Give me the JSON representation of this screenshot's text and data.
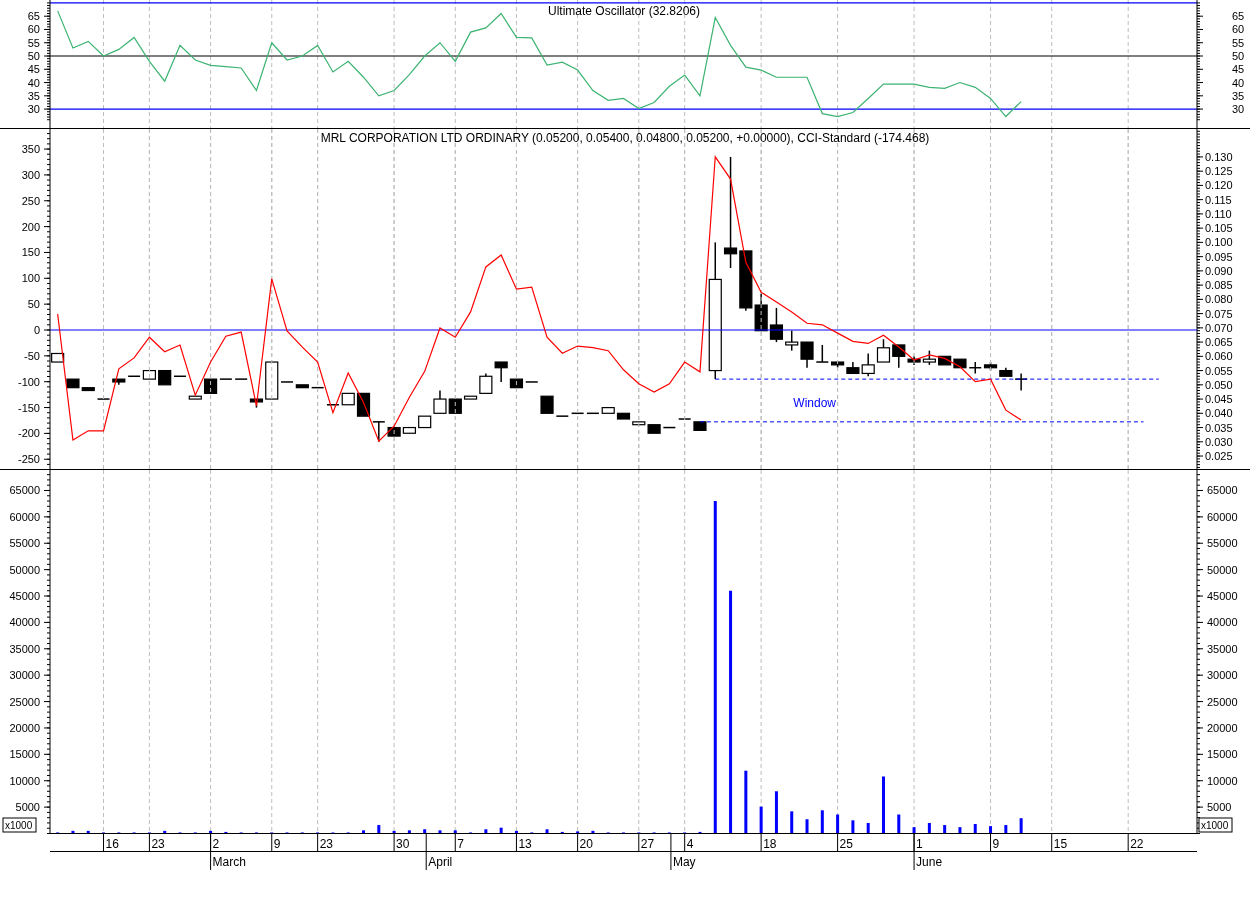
{
  "oscillator_panel": {
    "chart_data": {
      "type": "line",
      "title": "Ultimate Oscillator (32.8206)",
      "grid": true,
      "categories": [
        null,
        null,
        null,
        null,
        null,
        null,
        null,
        null,
        null,
        null,
        null,
        null,
        null,
        null,
        null,
        null,
        null,
        null,
        null,
        null,
        null,
        null,
        null,
        null,
        null,
        null,
        null,
        null,
        null,
        null,
        null,
        null,
        null,
        null,
        null,
        null,
        null,
        null,
        null,
        null,
        null,
        null,
        null,
        null,
        null,
        null,
        null,
        null,
        null,
        null,
        null,
        null,
        null,
        null,
        null,
        null,
        null,
        null,
        null,
        null,
        null,
        null,
        null,
        null,
        null,
        null,
        null,
        null,
        null,
        null,
        null,
        null,
        null,
        null,
        null
      ],
      "series": [
        {
          "color": "#3cb371",
          "values": [
            67,
            53,
            55.5,
            50,
            52.5,
            57,
            48,
            40.5,
            54,
            48.5,
            46.5,
            46,
            45.5,
            37,
            55,
            48.5,
            50,
            54,
            44,
            48,
            42,
            35,
            37,
            43,
            50,
            55,
            48,
            59,
            60.6,
            66,
            57,
            56.8,
            46.6,
            47.7,
            44.7,
            37,
            33.3,
            34,
            30.2,
            32.5,
            38.6,
            42.8,
            35,
            64.5,
            54,
            45.8,
            44.7,
            42,
            42,
            42,
            28.3,
            27.2,
            28.7,
            34,
            39.4,
            39.4,
            39.4,
            38.2,
            37.8,
            40,
            38.2,
            34,
            27.2,
            32.8,
            null,
            null,
            null,
            null,
            null,
            null,
            null,
            null,
            null,
            null,
            null
          ]
        }
      ],
      "ylim": [
        22.5,
        71.1
      ],
      "yticks": [
        30,
        35,
        40,
        45,
        50,
        55,
        60,
        65
      ],
      "y2lim": [
        22.5,
        71.1
      ],
      "y2ticks": [
        30,
        35,
        40,
        45,
        50,
        55,
        60,
        65
      ],
      "ref_lines": [
        {
          "axis": "y",
          "value": 70,
          "color": "#0000ff"
        },
        {
          "axis": "y",
          "value": 50,
          "color": "#000000"
        },
        {
          "axis": "y",
          "value": 30,
          "color": "#0000ff"
        }
      ]
    }
  },
  "price_panel": {
    "title": "MRL CORPORATION LTD ORDINARY (0.05200, 0.05400, 0.04800, 0.05200, +0.00000), CCI-Standard (-174.468)",
    "price_chart": {
      "chart_data": {
        "type": "candlestick",
        "grid": true,
        "categories": [
          null,
          null,
          null,
          null,
          null,
          null,
          null,
          null,
          null,
          null,
          null,
          null,
          null,
          null,
          null,
          null,
          null,
          null,
          null,
          null,
          null,
          null,
          null,
          null,
          null,
          null,
          null,
          null,
          null,
          null,
          null,
          null,
          null,
          null,
          null,
          null,
          null,
          null,
          null,
          null,
          null,
          null,
          null,
          null,
          null,
          null,
          null,
          null,
          null,
          null,
          null,
          null,
          null,
          null,
          null,
          null,
          null,
          null,
          null,
          null,
          null,
          null,
          null,
          null,
          null,
          null,
          null,
          null,
          null,
          null,
          null,
          null,
          null,
          null,
          null
        ],
        "ohlc": [
          [
            0.058,
            0.061,
            0.058,
            0.061
          ],
          [
            0.052,
            0.052,
            0.049,
            0.049
          ],
          [
            0.049,
            0.049,
            0.048,
            0.048
          ],
          [
            0.045,
            0.045,
            0.045,
            0.045
          ],
          [
            0.052,
            0.052,
            0.05,
            0.051
          ],
          [
            0.053,
            0.053,
            0.053,
            0.053
          ],
          [
            0.052,
            0.055,
            0.052,
            0.055
          ],
          [
            0.055,
            0.055,
            0.05,
            0.05
          ],
          [
            0.053,
            0.053,
            0.053,
            0.053
          ],
          [
            0.045,
            0.046,
            0.045,
            0.046
          ],
          [
            0.052,
            0.052,
            0.047,
            0.047
          ],
          [
            0.052,
            0.052,
            0.052,
            0.052
          ],
          [
            0.052,
            0.052,
            0.052,
            0.052
          ],
          [
            0.045,
            0.045,
            0.042,
            0.044
          ],
          [
            0.045,
            0.058,
            0.045,
            0.058
          ],
          [
            0.051,
            0.051,
            0.051,
            0.051
          ],
          [
            0.05,
            0.05,
            0.049,
            0.049
          ],
          [
            0.049,
            0.049,
            0.049,
            0.049
          ],
          [
            0.043,
            0.043,
            0.043,
            0.043
          ],
          [
            0.043,
            0.047,
            0.043,
            0.047
          ],
          [
            0.047,
            0.047,
            0.039,
            0.039
          ],
          [
            0.037,
            0.037,
            0.03,
            0.037
          ],
          [
            0.035,
            0.035,
            0.032,
            0.032
          ],
          [
            0.033,
            0.035,
            0.033,
            0.035
          ],
          [
            0.035,
            0.039,
            0.035,
            0.039
          ],
          [
            0.04,
            0.048,
            0.04,
            0.045
          ],
          [
            0.045,
            0.045,
            0.04,
            0.04
          ],
          [
            0.045,
            0.046,
            0.045,
            0.046
          ],
          [
            0.047,
            0.054,
            0.047,
            0.053
          ],
          [
            0.058,
            0.058,
            0.051,
            0.056
          ],
          [
            0.052,
            0.052,
            0.049,
            0.049
          ],
          [
            0.051,
            0.051,
            0.051,
            0.051
          ],
          [
            0.046,
            0.046,
            0.04,
            0.04
          ],
          [
            0.039,
            0.039,
            0.039,
            0.039
          ],
          [
            0.04,
            0.04,
            0.04,
            0.04
          ],
          [
            0.04,
            0.04,
            0.04,
            0.04
          ],
          [
            0.04,
            0.042,
            0.04,
            0.042
          ],
          [
            0.04,
            0.04,
            0.038,
            0.038
          ],
          [
            0.036,
            0.037,
            0.036,
            0.037
          ],
          [
            0.036,
            0.036,
            0.033,
            0.033
          ],
          [
            0.035,
            0.035,
            0.035,
            0.035
          ],
          [
            0.038,
            0.038,
            0.038,
            0.038
          ],
          [
            0.037,
            0.037,
            0.034,
            0.034
          ],
          [
            0.055,
            0.1,
            0.052,
            0.087
          ],
          [
            0.098,
            0.13,
            0.091,
            0.096
          ],
          [
            0.097,
            0.097,
            0.076,
            0.077
          ],
          [
            0.078,
            0.082,
            0.069,
            0.069
          ],
          [
            0.071,
            0.077,
            0.065,
            0.066
          ],
          [
            0.064,
            0.069,
            0.062,
            0.065
          ],
          [
            0.065,
            0.065,
            0.056,
            0.059
          ],
          [
            0.058,
            0.064,
            0.058,
            0.058
          ],
          [
            0.058,
            0.058,
            0.056,
            0.057
          ],
          [
            0.056,
            0.058,
            0.054,
            0.054
          ],
          [
            0.054,
            0.061,
            0.053,
            0.057
          ],
          [
            0.058,
            0.066,
            0.058,
            0.063
          ],
          [
            0.064,
            0.064,
            0.056,
            0.06
          ],
          [
            0.059,
            0.06,
            0.057,
            0.058
          ],
          [
            0.058,
            0.062,
            0.057,
            0.059
          ],
          [
            0.06,
            0.06,
            0.057,
            0.057
          ],
          [
            0.059,
            0.059,
            0.056,
            0.056
          ],
          [
            0.056,
            0.058,
            0.054,
            0.056
          ],
          [
            0.057,
            0.058,
            0.055,
            0.056
          ],
          [
            0.055,
            0.056,
            0.053,
            0.053
          ],
          [
            0.052,
            0.054,
            0.048,
            0.052
          ],
          null,
          null,
          null,
          null,
          null,
          null,
          null,
          null,
          null,
          null,
          null
        ],
        "ylim": [
          0.0201,
          0.1398
        ],
        "yticks": [
          {
            "value": 0.025,
            "label": "0.025"
          },
          {
            "value": 0.03,
            "label": "0.030"
          },
          {
            "value": 0.035,
            "label": "0.035"
          },
          {
            "value": 0.04,
            "label": "0.040"
          },
          {
            "value": 0.045,
            "label": "0.045"
          },
          {
            "value": 0.05,
            "label": "0.050"
          },
          {
            "value": 0.055,
            "label": "0.055"
          },
          {
            "value": 0.06,
            "label": "0.060"
          },
          {
            "value": 0.065,
            "label": "0.065"
          },
          {
            "value": 0.07,
            "label": "0.070"
          },
          {
            "value": 0.075,
            "label": "0.075"
          },
          {
            "value": 0.08,
            "label": "0.080"
          },
          {
            "value": 0.085,
            "label": "0.085"
          },
          {
            "value": 0.09,
            "label": "0.090"
          },
          {
            "value": 0.095,
            "label": "0.095"
          },
          {
            "value": 0.1,
            "label": "0.100"
          },
          {
            "value": 0.105,
            "label": "0.105"
          },
          {
            "value": 0.11,
            "label": "0.110"
          },
          {
            "value": 0.115,
            "label": "0.115"
          },
          {
            "value": 0.12,
            "label": "0.120"
          },
          {
            "value": 0.125,
            "label": "0.125"
          },
          {
            "value": 0.13,
            "label": "0.130"
          }
        ],
        "ref_lines": [
          {
            "axis": "y",
            "value": 0.052,
            "color": "#0000ff"
          },
          {
            "axis": "y",
            "value": 0.037,
            "color": "#0000ff"
          }
        ],
        "annotations": [
          "Window"
        ]
      }
    },
    "cci_chart": {
      "chart_data": {
        "type": "line",
        "grid": true,
        "categories": [
          null,
          null,
          null,
          null,
          null,
          null,
          null,
          null,
          null,
          null,
          null,
          null,
          null,
          null,
          null,
          null,
          null,
          null,
          null,
          null,
          null,
          null,
          null,
          null,
          null,
          null,
          null,
          null,
          null,
          null,
          null,
          null,
          null,
          null,
          null,
          null,
          null,
          null,
          null,
          null,
          null,
          null,
          null,
          null,
          null,
          null,
          null,
          null,
          null,
          null,
          null,
          null,
          null,
          null,
          null,
          null,
          null,
          null,
          null,
          null,
          null,
          null,
          null,
          null,
          null,
          null,
          null,
          null,
          null,
          null,
          null,
          null,
          null,
          null,
          null
        ],
        "series": [
          {
            "color": "#ff0000",
            "values": [
              31,
              -213,
              -195,
              -195,
              -75,
              -54,
              -14,
              -42,
              -29,
              -126,
              -62,
              -12,
              -4,
              -147,
              99,
              -2,
              -33,
              -62,
              -160,
              -83,
              -140,
              -215,
              -186,
              -130,
              -80,
              4,
              -14,
              35,
              122,
              145,
              79,
              83,
              -14,
              -45,
              -31,
              -34,
              -40,
              -77,
              -104,
              -120,
              -104,
              -62,
              -81,
              335,
              292,
              131,
              73,
              54,
              35,
              13,
              10,
              -6,
              -22,
              -26,
              -10,
              -33,
              -58,
              -48,
              -55,
              -71,
              -100,
              -95,
              -155,
              -174,
              null,
              null,
              null,
              null,
              null,
              null,
              null,
              null,
              null,
              null,
              null
            ]
          }
        ],
        "ylim": [
          -270.8,
          388.8
        ],
        "yticks": [
          -250,
          -200,
          -150,
          -100,
          -50,
          0,
          50,
          100,
          150,
          200,
          250,
          300,
          350
        ],
        "ref_lines": [
          {
            "axis": "y",
            "value": 0,
            "color": "#0000ff"
          }
        ]
      }
    }
  },
  "volume_panel": {
    "chart_data": {
      "type": "bar",
      "grid": true,
      "ylabel": "x1000",
      "y2label": "x1000",
      "categories": [
        null,
        null,
        null,
        null,
        null,
        null,
        null,
        null,
        null,
        null,
        null,
        null,
        null,
        null,
        null,
        null,
        null,
        null,
        null,
        null,
        null,
        null,
        null,
        null,
        null,
        null,
        null,
        null,
        null,
        null,
        null,
        null,
        null,
        null,
        null,
        null,
        null,
        null,
        null,
        null,
        null,
        null,
        null,
        null,
        null,
        null,
        null,
        null,
        null,
        null,
        null,
        null,
        null,
        null,
        null,
        null,
        null,
        null,
        null,
        null,
        null,
        null,
        null,
        null,
        null,
        null,
        null,
        null,
        null,
        null,
        null,
        null,
        null,
        null,
        null
      ],
      "series": [
        {
          "color": "#0000ff",
          "values": [
            200,
            500,
            500,
            200,
            200,
            200,
            200,
            500,
            200,
            200,
            500,
            300,
            200,
            200,
            200,
            200,
            200,
            200,
            200,
            200,
            600,
            1600,
            500,
            600,
            800,
            600,
            600,
            200,
            800,
            1100,
            500,
            200,
            800,
            300,
            400,
            500,
            200,
            200,
            200,
            200,
            200,
            200,
            300,
            63000,
            46000,
            11900,
            5100,
            8000,
            4200,
            2700,
            4400,
            3600,
            2500,
            2000,
            10800,
            3600,
            1200,
            2000,
            1600,
            1200,
            1800,
            1400,
            1600,
            2900,
            null,
            null,
            null,
            null,
            null,
            null,
            null,
            null,
            null,
            null,
            null
          ]
        }
      ],
      "ylim": [
        0,
        68880
      ],
      "yticks": [
        5000,
        10000,
        15000,
        20000,
        25000,
        30000,
        35000,
        40000,
        45000,
        50000,
        55000,
        60000,
        65000
      ],
      "y2lim": [
        0,
        68880
      ],
      "y2ticks": [
        5000,
        10000,
        15000,
        20000,
        25000,
        30000,
        35000,
        40000,
        45000,
        50000,
        55000,
        60000,
        65000
      ]
    }
  },
  "date_axis": {
    "days": [
      "16",
      "23",
      "2",
      "9",
      "23",
      "30",
      "7",
      "13",
      "20",
      "27",
      "4",
      "18",
      "25",
      "1",
      "9",
      "15",
      "22"
    ],
    "months": [
      "March",
      "April",
      "May",
      "June"
    ]
  }
}
